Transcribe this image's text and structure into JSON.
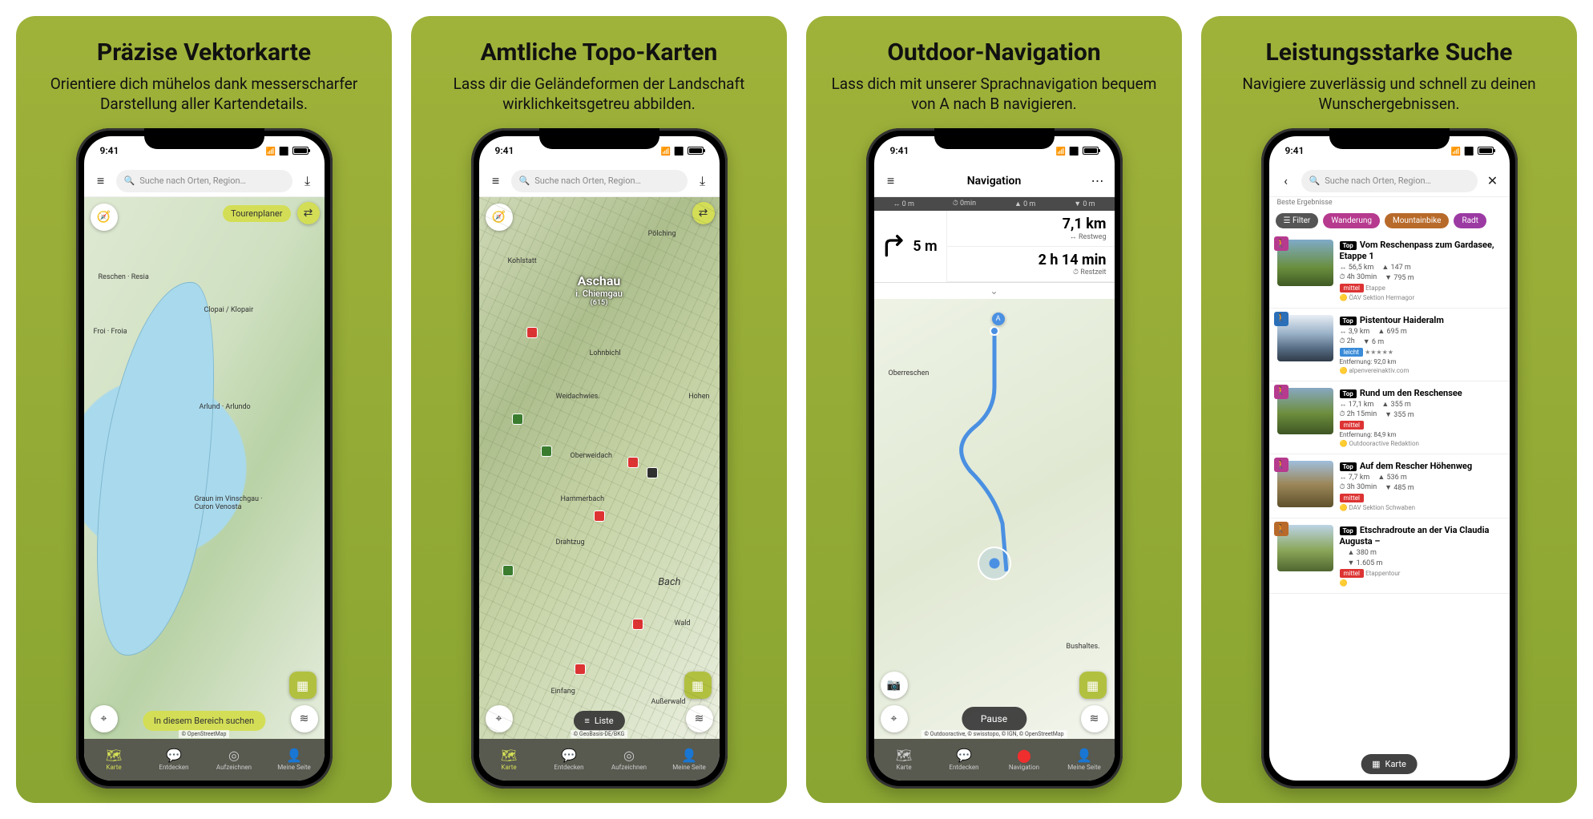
{
  "cards": [
    {
      "title": "Präzise Vektorkarte",
      "subtitle": "Orientiere dich mühelos dank messerscharfer Darstellung aller Kartendetails."
    },
    {
      "title": "Amtliche Topo-Karten",
      "subtitle": "Lass dir die Geländeformen der Landschaft wirklichkeitsgetreu abbilden."
    },
    {
      "title": "Outdoor-Navigation",
      "subtitle": "Lass dich mit unserer Sprachnavigation bequem von A nach B navigieren."
    },
    {
      "title": "Leistungsstarke Suche",
      "subtitle": "Navigiere zuverlässig und schnell zu deinen Wunschergebnissen."
    }
  ],
  "status_time": "9:41",
  "search_placeholder": "Suche nach Orten, Region…",
  "tourenplaner": "Tourenplaner",
  "search_area": "In diesem Bereich suchen",
  "attr1": "© OpenStreetMap",
  "attr2": "© GeoBasis-DE/BKG",
  "attr3": "© Outdooractive, © swisstopo, © IGN, © OpenStreetMap",
  "liste_label": "Liste",
  "map1_labels": {
    "a": "Reschen · Resia",
    "b": "Froi · Froia",
    "c": "Clopai / Klopair",
    "d": "Arlund · Arlundo",
    "e": "Graun im Vinschgau · Curon Venosta"
  },
  "map2": {
    "town": "Aschau",
    "region": "i. Chiemgau",
    "alt": "(615)",
    "p": [
      "Pölching",
      "Kohlstatt",
      "Lohnbichl",
      "Weidachwies.",
      "Hohen",
      "Oberweidach",
      "Hammerbach",
      "Drahtzug",
      "Bach",
      "Wald",
      "Außerwald",
      "Einfang"
    ]
  },
  "nav": {
    "header": "Navigation",
    "bar": [
      "↔ 0 m",
      "⏱ 0min",
      "▲ 0 m",
      "▼ 0 m"
    ],
    "turn_dist": "5 m",
    "dist": "7,1 km",
    "dist_lbl": "↔ Restweg",
    "time": "2 h 14 min",
    "time_lbl": "⏱ Restzeit",
    "pause": "Pause",
    "place1": "Oberreschen",
    "place2": "Bushaltes."
  },
  "search": {
    "best": "Beste Ergebnisse",
    "karte": "Karte",
    "chips": [
      {
        "label": "Filter",
        "color": "#555"
      },
      {
        "label": "Wanderung",
        "color": "#b63a8e"
      },
      {
        "label": "Mountainbike",
        "color": "#b86a2a"
      },
      {
        "label": "Radt",
        "color": "#9c3aa3"
      }
    ],
    "results": [
      {
        "cat_color": "#b63a8e",
        "thumb": "linear-gradient(180deg,#7faac8 0%,#6a8f3e 60%,#3f5a24 100%)",
        "title": "Vom Reschenpass zum Gardasee, Etappe 1",
        "row1": "↔ 56,5 km",
        "row1b": "▲ 147 m",
        "row2": "⏱ 4h 30min",
        "row2b": "▼ 795 m",
        "diff": "mittel",
        "diff_color": "#d33",
        "extra": "Etappe",
        "src": "ÖAV Sektion Hermagor"
      },
      {
        "cat_color": "#2a6fb8",
        "thumb": "linear-gradient(180deg,#e9eef5 0%,#9ab2c8 40%,#5a7189 70%,#2f3b48 100%)",
        "title": "Pistentour Haideralm",
        "row1": "↔ 3,9 km",
        "row1b": "▲ 695 m",
        "row2": "⏱ 2h",
        "row2b": "▼ 6 m",
        "diff": "leicht",
        "diff_color": "#3a8bd8",
        "extra": "★★★★★",
        "dist": "Entfernung: 92,0 km",
        "src": "alpenvereinaktiv.com"
      },
      {
        "cat_color": "#b63a8e",
        "thumb": "linear-gradient(180deg,#88a8c2 0%,#6d8e3c 55%,#3e5524 100%)",
        "title": "Rund um den Reschensee",
        "row1": "↔ 17,1 km",
        "row1b": "▲ 355 m",
        "row2": "⏱ 2h 15min",
        "row2b": "▼ 355 m",
        "diff": "mittel",
        "diff_color": "#d33",
        "dist": "Entfernung: 84,9 km",
        "src": "Outdooractive Redaktion"
      },
      {
        "cat_color": "#b63a8e",
        "thumb": "linear-gradient(180deg,#9fbedd 0%,#9c8759 50%,#5e512c 100%)",
        "title": "Auf dem Rescher Höhenweg",
        "row1": "↔ 7,7 km",
        "row1b": "▲ 536 m",
        "row2": "⏱ 3h 30min",
        "row2b": "▼ 485 m",
        "diff": "mittel",
        "diff_color": "#d33",
        "src": "DAV Sektion Schwaben"
      },
      {
        "cat_color": "#b86a2a",
        "thumb": "linear-gradient(180deg,#bcd3e6 0%,#8aa658 55%,#4f6630 100%)",
        "title": "Etschradroute an der Via Claudia Augusta –",
        "row1": "",
        "row1b": "▲ 380 m",
        "row2": "",
        "row2b": "▼ 1.605 m",
        "diff": "mittel",
        "diff_color": "#d33",
        "extra": "Etappentour",
        "src": ""
      }
    ]
  },
  "tabs": [
    {
      "icon": "🗺",
      "label": "Karte"
    },
    {
      "icon": "💬",
      "label": "Entdecken"
    },
    {
      "icon": "◎",
      "label": "Aufzeichnen"
    },
    {
      "icon": "👤",
      "label": "Meine Seite"
    }
  ],
  "tabs_nav": [
    {
      "icon": "🗺",
      "label": "Karte"
    },
    {
      "icon": "💬",
      "label": "Entdecken"
    },
    {
      "icon": "⬤",
      "label": "Navigation"
    },
    {
      "icon": "👤",
      "label": "Meine Seite"
    }
  ]
}
